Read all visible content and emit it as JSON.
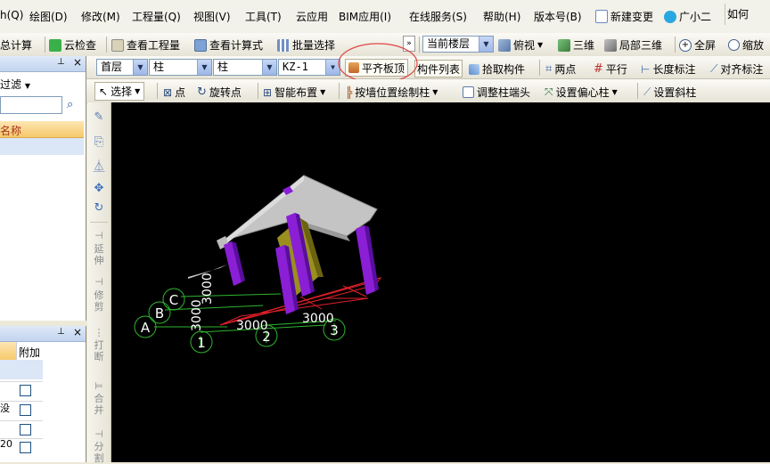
{
  "menu": [
    "h(Q)",
    "绘图(D)",
    "修改(M)",
    "工程量(Q)",
    "视图(V)",
    "工具(T)",
    "云应用",
    "BIM应用(I)",
    "在线服务(S)",
    "帮助(H)",
    "版本号(B)",
    "新建变更",
    "广小二",
    "如何"
  ],
  "toolbar1": {
    "summary": "汇总计算",
    "cloud_check": "云检查",
    "view_quantity": "查看工程量",
    "view_formula": "查看计算式",
    "batch_select": "批量选择",
    "current_floor": "当前楼层",
    "top_view": "俯视",
    "view_3d": "三维",
    "local_3d": "局部三维",
    "fullscreen": "全屏",
    "zoom": "缩放"
  },
  "toolbar2": {
    "floor": "首层",
    "type": "柱",
    "subtype": "柱",
    "component": "KZ-1",
    "align_slab_top": "平齐板顶",
    "component_list": "构件列表",
    "pick_component": "拾取构件",
    "two_points": "两点",
    "parallel": "平行",
    "length_dim": "长度标注",
    "align_dim": "对齐标注"
  },
  "toolbar3": {
    "select": "选择",
    "point": "点",
    "rotate_point": "旋转点",
    "smart_layout": "智能布置",
    "draw_by_wall": "按墙位置绘制柱",
    "adjust_column_end": "调整柱端头",
    "set_offset_column": "设置偏心柱",
    "set_slanted_column": "设置斜柱"
  },
  "left_panel_top": {
    "filter": "过滤",
    "header": "名称"
  },
  "left_panel_bottom": {
    "header_extra": "附加",
    "row_labels": [
      "",
      "",
      "没",
      "",
      "20",
      ""
    ]
  },
  "vertical_tools": [
    "延伸",
    "修剪",
    "打断",
    "合并",
    "分割"
  ],
  "canvas": {
    "axis_rows": [
      "A",
      "B",
      "C"
    ],
    "axis_cols": [
      "1",
      "2",
      "3"
    ],
    "dims_x": [
      "3000",
      "3000"
    ],
    "dims_y": [
      "3000",
      "3000"
    ]
  },
  "colors": {
    "column": "#8a1fd6",
    "slab": "#c4c4c4",
    "grid_red": "#e0202a",
    "axis_green": "#2fb52f",
    "highlight": "#e04545"
  }
}
